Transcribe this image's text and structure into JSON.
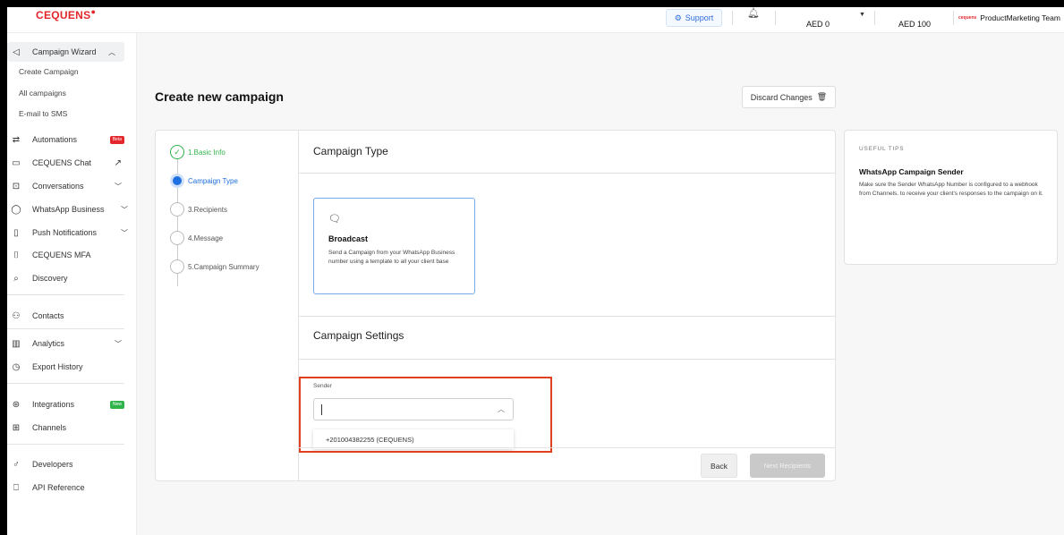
{
  "header": {
    "logo": "CEQUENS",
    "support_label": "Support",
    "balance_1": "AED 0",
    "balance_2": "AED 100",
    "team_name": "ProductMarketing Team",
    "team_logo_text": "cequens"
  },
  "sidebar": {
    "campaign_wizard": "Campaign Wizard",
    "create_campaign": "Create Campaign",
    "all_campaigns": "All campaigns",
    "email_to_sms": "E-mail to SMS",
    "automations": "Automations",
    "automations_badge": "Beta",
    "cequens_chat": "CEQUENS Chat",
    "conversations": "Conversations",
    "whatsapp_business": "WhatsApp Business",
    "push_notifications": "Push Notifications",
    "cequens_mfa": "CEQUENS MFA",
    "discovery": "Discovery",
    "contacts": "Contacts",
    "analytics": "Analytics",
    "export_history": "Export History",
    "integrations": "Integrations",
    "integrations_badge": "New",
    "channels": "Channels",
    "developers": "Developers",
    "api_reference": "API Reference"
  },
  "main": {
    "title": "Create new campaign",
    "discard_label": "Discard Changes",
    "steps": [
      {
        "label": "1.Basic Info",
        "state": "done"
      },
      {
        "label": "Campaign Type",
        "state": "active"
      },
      {
        "label": "3.Recipients",
        "state": "pending"
      },
      {
        "label": "4.Message",
        "state": "pending"
      },
      {
        "label": "5.Campaign Summary",
        "state": "pending"
      }
    ],
    "campaign_type_title": "Campaign Type",
    "broadcast_title": "Broadcast",
    "broadcast_desc": "Send a Campaign from your WhatsApp Business number using a template to all your client base",
    "campaign_settings_title": "Campaign Settings",
    "sender_label": "Sender",
    "sender_value": "",
    "sender_option": "+201004382255 (CEQUENS)",
    "back_label": "Back",
    "next_label": "Next Recipients"
  },
  "tips": {
    "heading": "USEFUL TIPS",
    "title": "WhatsApp Campaign Sender",
    "body": "Make sure the Sender WhatsApp Number is configured to a webhook from Channels. to receive your client's responses to the campaign on it."
  },
  "colors": {
    "brand": "#e3262b",
    "accent": "#1f6fe0",
    "success": "#2fb34a",
    "highlight": "#e0401f"
  }
}
